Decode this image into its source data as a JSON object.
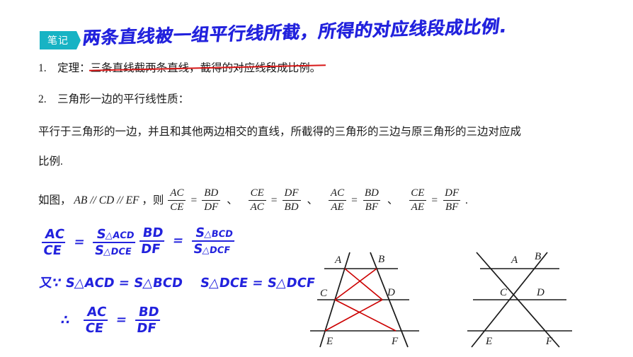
{
  "badge": {
    "label": "笔记"
  },
  "handwritten_title": "两条直线被一组平行线所截，所得的对应线段成比例.",
  "body": {
    "item1_prefix": "1.　定理：",
    "item1_struck": "三条直线截两条直线，截得的对应线段成比例。",
    "item2": "2.　三角形一边的平行线性质：",
    "paragraph_line1": "平行于三角形的一边，并且和其他两边相交的直线，所截得的三角形的三边与原三角形的三边对应成",
    "paragraph_line2": "比例.",
    "conclusion_prefix": "如图，",
    "parallel_statement": "AB // CD // EF",
    "conclusion_then": "，则",
    "period": "."
  },
  "proportions": [
    {
      "left_num": "AC",
      "left_den": "CE",
      "right_num": "BD",
      "right_den": "DF"
    },
    {
      "left_num": "CE",
      "left_den": "AC",
      "right_num": "DF",
      "right_den": "BD"
    },
    {
      "left_num": "AC",
      "left_den": "AE",
      "right_num": "BD",
      "right_den": "BF"
    },
    {
      "left_num": "CE",
      "left_den": "AE",
      "right_num": "DF",
      "right_den": "BF"
    }
  ],
  "separator": "、",
  "equals": "=",
  "handwritten_work": {
    "line1_left": {
      "num": "AC",
      "den": "CE"
    },
    "line1_right": {
      "num_main": "S",
      "num_sub": "△ACD",
      "den_main": "S",
      "den_sub": "△DCE"
    },
    "line2_left": {
      "num": "BD",
      "den": "DF"
    },
    "line2_right": {
      "num_main": "S",
      "num_sub": "△BCD",
      "den_main": "S",
      "den_sub": "△DCF"
    },
    "line3_because": "又∵",
    "line3_eq1": "S△ACD = S△BCD",
    "line3_eq2": "S△DCE = S△DCF",
    "line4_therefore": "∴",
    "line4_left": {
      "num": "AC",
      "den": "CE"
    },
    "line4_right": {
      "num": "BD",
      "den": "DF"
    }
  },
  "figures": [
    {
      "name": "figure-parallel-lines-trapezoid",
      "labels": [
        "A",
        "B",
        "C",
        "D",
        "E",
        "F"
      ],
      "highlight_color": "#cc0000",
      "line_color": "#1a1a1a"
    },
    {
      "name": "figure-parallel-lines-crossed",
      "labels": [
        "A",
        "B",
        "C",
        "D",
        "E",
        "F"
      ],
      "line_color": "#1a1a1a"
    }
  ],
  "colors": {
    "badge_bg": "#17b3c4",
    "handwriting": "#2222dd",
    "strikethrough": "#d81717",
    "figure_highlight": "#cc0000",
    "text": "#1a1a1a"
  }
}
